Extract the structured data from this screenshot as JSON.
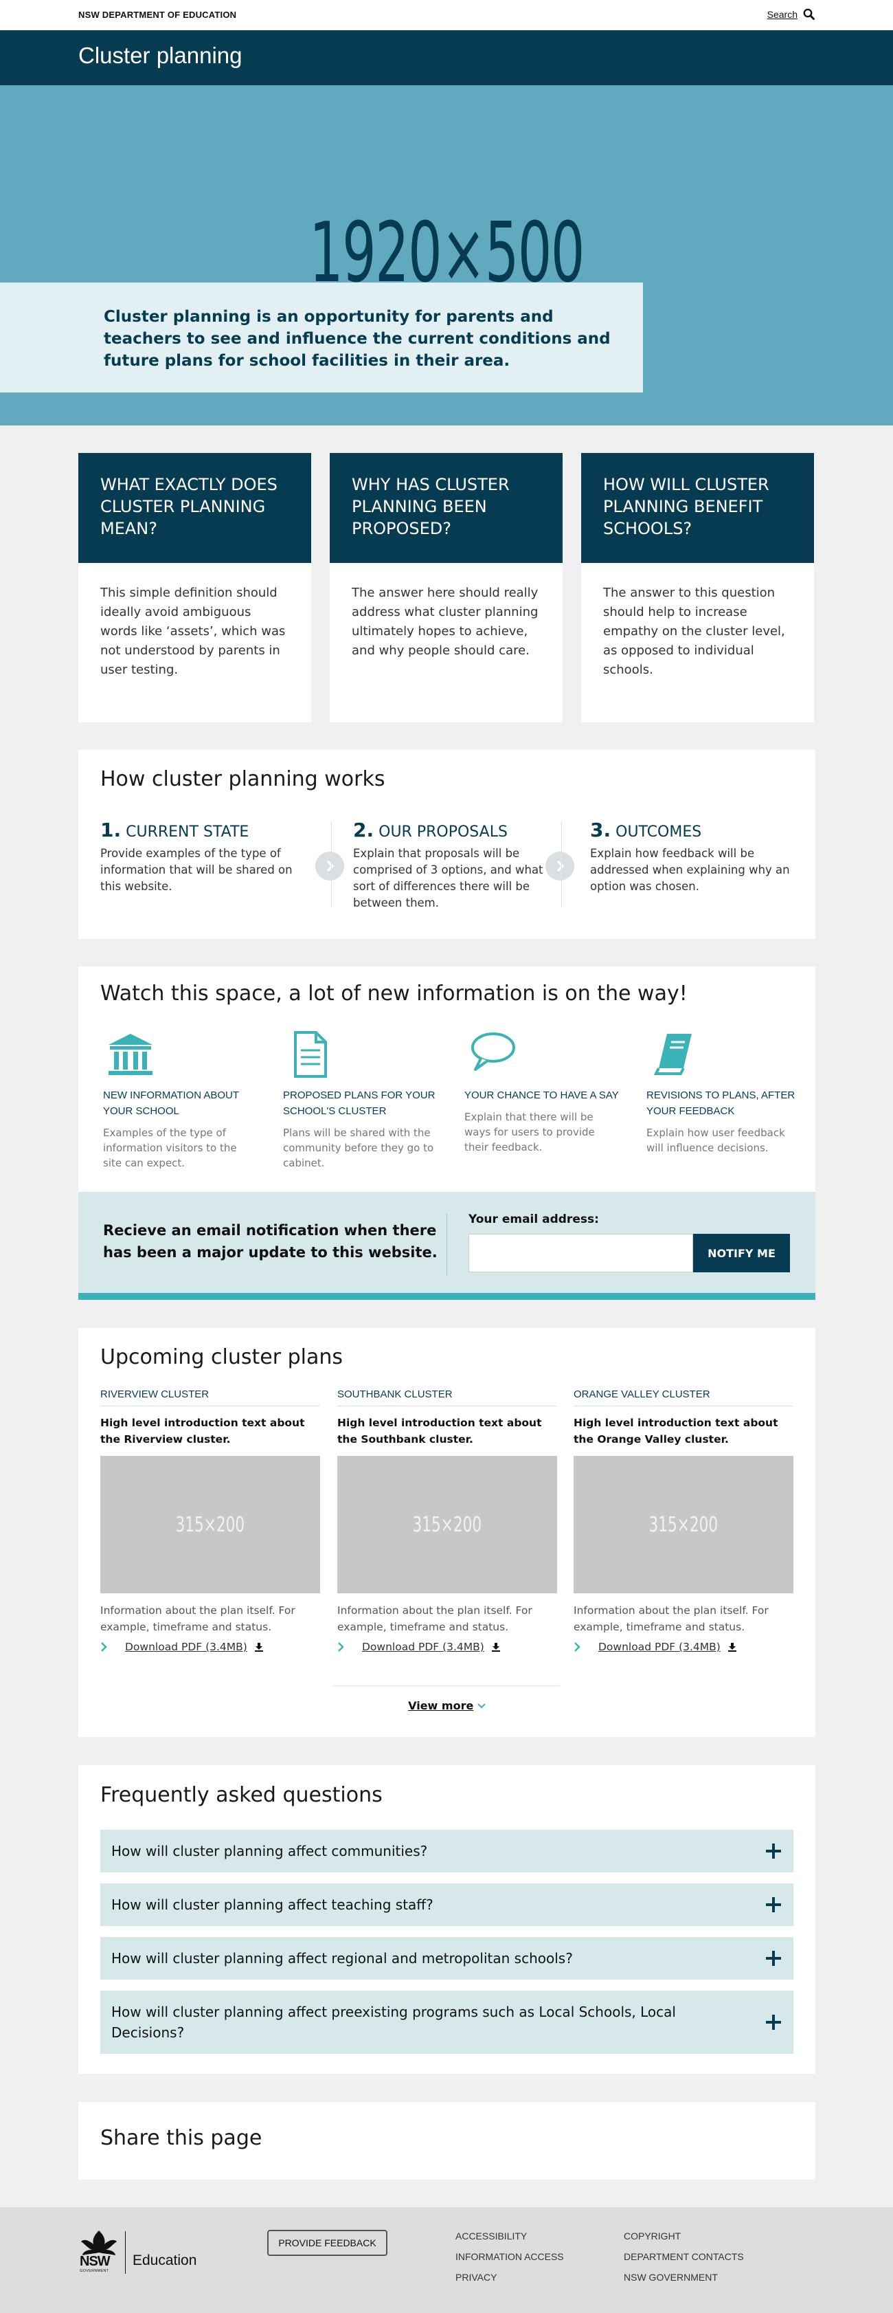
{
  "header": {
    "department": "NSW DEPARTMENT OF EDUCATION",
    "search_label": "Search",
    "page_title": "Cluster planning"
  },
  "hero": {
    "placeholder": "1920×500",
    "intro": "Cluster planning is an opportunity for parents and teachers to see and influence the current conditions and future plans for school facilities in their area."
  },
  "questions": [
    {
      "title": "WHAT EXACTLY DOES CLUSTER PLANNING MEAN?",
      "body": "This simple definition should ideally avoid ambiguous words like ‘assets’, which was not understood by parents in user testing."
    },
    {
      "title": "WHY HAS CLUSTER PLANNING BEEN PROPOSED?",
      "body": "The answer here should really address what cluster planning ultimately hopes to achieve, and why people should care."
    },
    {
      "title": "HOW WILL CLUSTER PLANNING BENEFIT SCHOOLS?",
      "body": "The answer to this question should help to increase empathy on the cluster level, as opposed to individual schools."
    }
  ],
  "how": {
    "title": "How cluster planning works",
    "steps": [
      {
        "num": "1.",
        "label": "CURRENT STATE",
        "desc": "Provide examples of the type of information that will be shared on this website."
      },
      {
        "num": "2.",
        "label": "OUR PROPOSALS",
        "desc": "Explain that proposals will be comprised of 3 options, and what sort of differences there will be between them."
      },
      {
        "num": "3.",
        "label": "OUTCOMES",
        "desc": "Explain how feedback will be addressed when explaining why an option was chosen."
      }
    ]
  },
  "watch": {
    "title": "Watch this space, a lot of new information is on the way!",
    "features": [
      {
        "icon": "building-icon",
        "title": "NEW INFORMATION ABOUT YOUR SCHOOL",
        "desc": "Examples of the type of information visitors to the site can expect."
      },
      {
        "icon": "document-icon",
        "title": "PROPOSED PLANS FOR YOUR SCHOOL'S CLUSTER",
        "desc": "Plans will be shared with the community before they go to cabinet."
      },
      {
        "icon": "speech-bubble-icon",
        "title": "YOUR CHANCE TO HAVE A SAY",
        "desc": "Explain that there will be ways for users to provide their feedback."
      },
      {
        "icon": "book-icon",
        "title": "REVISIONS TO PLANS, AFTER YOUR FEEDBACK",
        "desc": "Explain how user feedback will influence decisions."
      }
    ],
    "notify": {
      "message": "Recieve an email notification when there has been a major update to this website.",
      "email_label": "Your email address:",
      "email_value": "",
      "button": "NOTIFY ME"
    }
  },
  "upcoming": {
    "title": "Upcoming cluster plans",
    "plans": [
      {
        "name": "RIVERVIEW CLUSTER",
        "intro": "High level introduction text about the Riverview cluster.",
        "image": "315×200",
        "desc": "Information about the plan itself. For example, timeframe and status.",
        "download": "Download PDF (3.4MB)"
      },
      {
        "name": "SOUTHBANK CLUSTER",
        "intro": "High level introduction text about the Southbank cluster.",
        "image": "315×200",
        "desc": "Information about the plan itself. For example, timeframe and status.",
        "download": "Download PDF (3.4MB)"
      },
      {
        "name": "ORANGE VALLEY CLUSTER",
        "intro": "High level introduction text about the Orange Valley cluster.",
        "image": "315×200",
        "desc": "Information about the plan itself. For example, timeframe and status.",
        "download": "Download PDF (3.4MB)"
      }
    ],
    "view_more": "View more"
  },
  "faq": {
    "title": "Frequently asked questions",
    "items": [
      "How will cluster planning affect communities?",
      "How will cluster planning affect teaching staff?",
      "How will cluster planning affect regional and metropolitan schools?",
      "How will cluster planning affect preexisting programs such as Local Schools, Local Decisions?"
    ]
  },
  "share": {
    "title": "Share this page"
  },
  "footer": {
    "logo_text": "NSW",
    "logo_sub": "GOVERNMENT",
    "brand": "Education",
    "feedback_button": "PROVIDE FEEDBACK",
    "links_col1": [
      "ACCESSIBILITY",
      "INFORMATION ACCESS",
      "PRIVACY"
    ],
    "links_col2": [
      "COPYRIGHT",
      "DEPARTMENT CONTACTS",
      "NSW GOVERNMENT"
    ]
  },
  "colors": {
    "navy": "#063b52",
    "hero_blue": "#60a9bf",
    "teal": "#3bb3b6",
    "light_teal": "#d6e8e9"
  }
}
